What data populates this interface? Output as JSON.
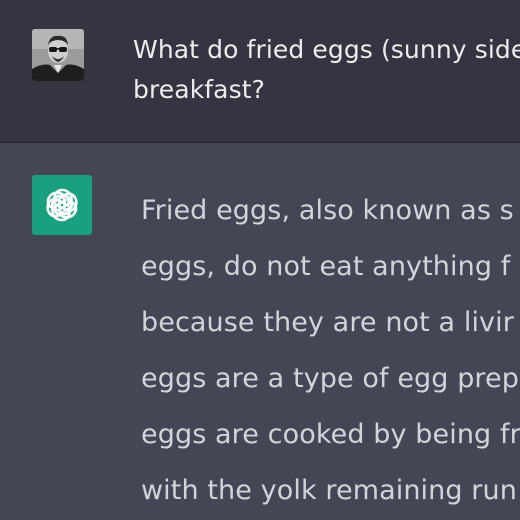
{
  "conversation": {
    "user_message": {
      "lines": [
        "What do fried eggs (sunny side",
        "breakfast?"
      ]
    },
    "assistant_message": {
      "lines": [
        "Fried eggs, also known as s",
        "eggs, do not eat anything f",
        "because they are not a livir",
        "eggs are a type of egg prep",
        "eggs are cooked by being fr",
        "with the yolk remaining run"
      ]
    }
  },
  "colors": {
    "user_bg": "#343541",
    "assistant_bg": "#444654",
    "bot_avatar_bg": "#19a07f"
  },
  "icons": {
    "user_avatar": "user-avatar-photo",
    "bot_avatar": "openai-logo-icon"
  }
}
